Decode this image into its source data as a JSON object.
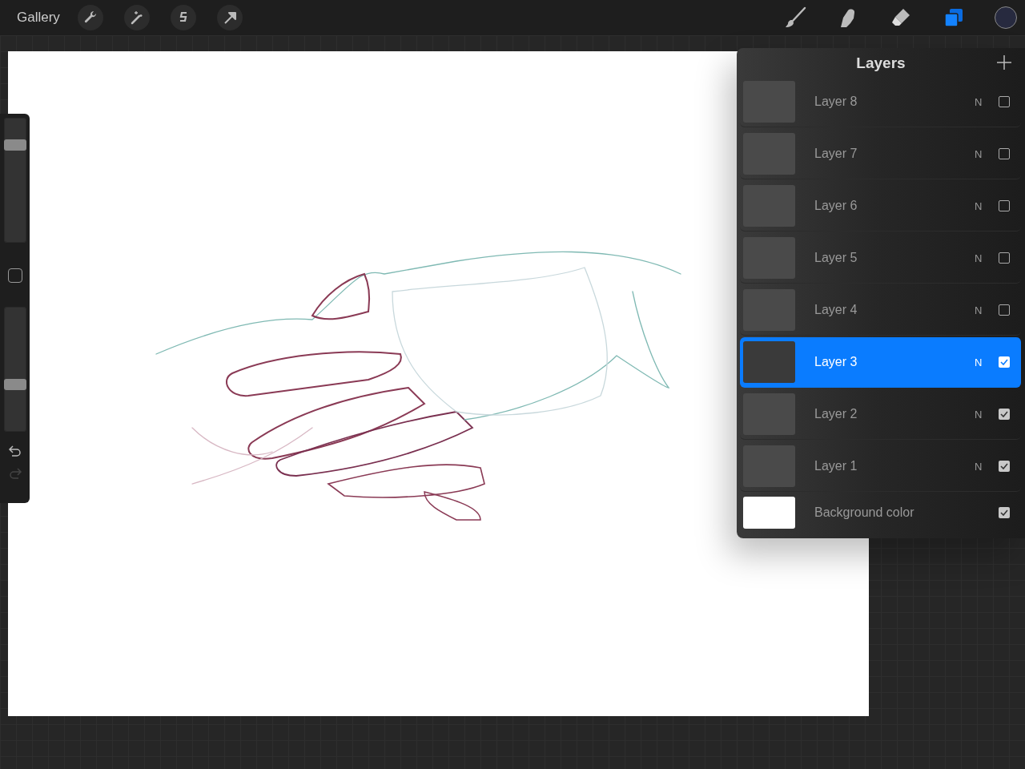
{
  "toolbar": {
    "gallery": "Gallery"
  },
  "sidebar": {
    "brush_size": {
      "level": 0.78
    },
    "opacity": {
      "level": 0.38
    }
  },
  "layers_panel": {
    "title": "Layers",
    "layers": [
      {
        "kind": "layer",
        "name": "Layer 8",
        "blend": "N",
        "visible": false,
        "selected": false
      },
      {
        "kind": "layer",
        "name": "Layer 7",
        "blend": "N",
        "visible": false,
        "selected": false
      },
      {
        "kind": "layer",
        "name": "Layer 6",
        "blend": "N",
        "visible": false,
        "selected": false
      },
      {
        "kind": "layer",
        "name": "Layer 5",
        "blend": "N",
        "visible": false,
        "selected": false
      },
      {
        "kind": "layer",
        "name": "Layer 4",
        "blend": "N",
        "visible": false,
        "selected": false
      },
      {
        "kind": "layer",
        "name": "Layer 3",
        "blend": "N",
        "visible": true,
        "selected": true
      },
      {
        "kind": "layer",
        "name": "Layer 2",
        "blend": "N",
        "visible": true,
        "selected": false
      },
      {
        "kind": "layer",
        "name": "Layer 1",
        "blend": "N",
        "visible": true,
        "selected": false
      },
      {
        "kind": "background",
        "name": "Background color",
        "visible": true,
        "selected": false
      }
    ]
  }
}
